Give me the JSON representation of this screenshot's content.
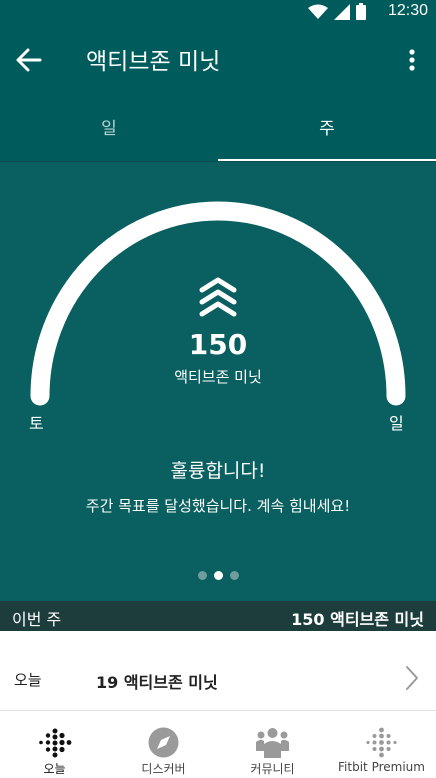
{
  "status_bar": {
    "time": "12:30"
  },
  "app_bar": {
    "title": "액티브존 미닛"
  },
  "tabs": [
    {
      "label": "일",
      "active": false
    },
    {
      "label": "주",
      "active": true
    }
  ],
  "hero": {
    "value": "150",
    "unit_label": "액티브존 미닛",
    "gauge_start_label": "토",
    "gauge_end_label": "일",
    "goal_progress": 1.0,
    "title": "훌륭합니다!",
    "message": "주간 목표를 달성했습니다. 계속 힘내세요!",
    "pager": {
      "count": 3,
      "active_index": 1
    }
  },
  "week_summary": {
    "label": "이번 주",
    "value": "150 액티브존 미닛"
  },
  "today_row": {
    "label": "오늘",
    "value": "19 액티브존 미닛"
  },
  "bottom_nav": [
    {
      "label": "오늘",
      "icon": "fitbit-dots-icon",
      "active": true
    },
    {
      "label": "디스커버",
      "icon": "compass-icon",
      "active": false
    },
    {
      "label": "커뮤니티",
      "icon": "community-icon",
      "active": false
    },
    {
      "label": "Fitbit Premium",
      "icon": "premium-dots-icon",
      "active": false
    }
  ],
  "colors": {
    "header": "#005c5c",
    "hero_background": "#0a6060",
    "week_bar": "#1d3c3c",
    "gauge": "#ffffff"
  }
}
